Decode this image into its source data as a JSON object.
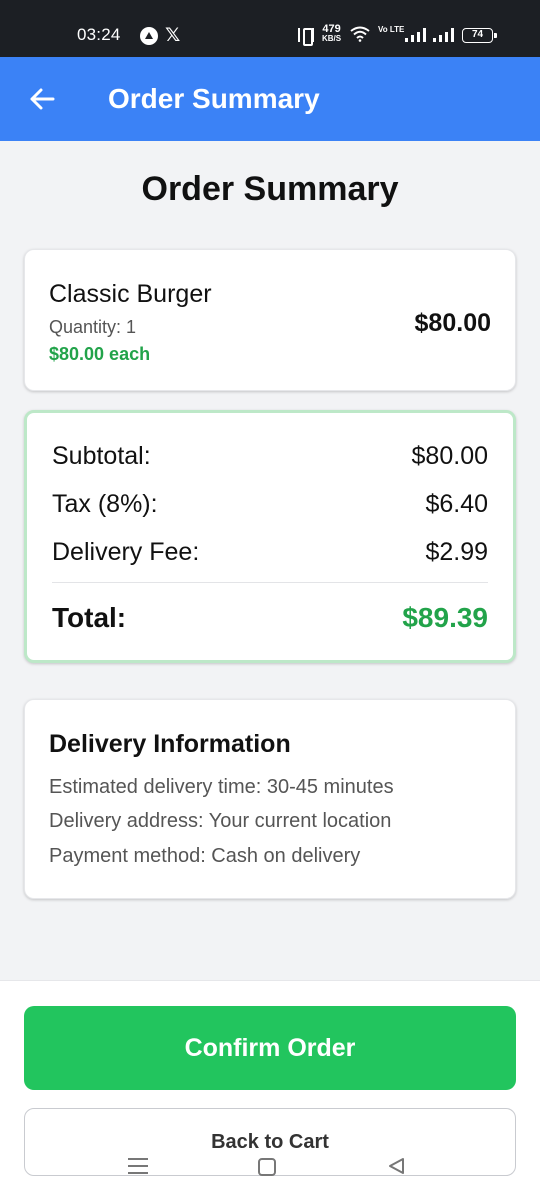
{
  "status_bar": {
    "time": "03:24",
    "speed_value": "479",
    "speed_unit": "KB/S",
    "network": "Vo LTE",
    "battery": "74"
  },
  "app_bar": {
    "title": "Order Summary",
    "back_icon": "arrow-left-icon",
    "color": "#3b82f6"
  },
  "page": {
    "title": "Order Summary"
  },
  "item": {
    "name": "Classic Burger",
    "quantity": "Quantity: 1",
    "unit_price": "$80.00 each",
    "total": "$80.00"
  },
  "totals": {
    "subtotal_label": "Subtotal:",
    "subtotal_value": "$80.00",
    "tax_label": "Tax (8%):",
    "tax_value": "$6.40",
    "delivery_label": "Delivery Fee:",
    "delivery_value": "$2.99",
    "total_label": "Total:",
    "total_value": "$89.39",
    "accent_color": "#22a34a"
  },
  "delivery": {
    "title": "Delivery Information",
    "eta": "Estimated delivery time: 30-45 minutes",
    "address": "Delivery address: Your current location",
    "payment": "Payment method: Cash on delivery"
  },
  "actions": {
    "confirm_label": "Confirm Order",
    "confirm_color": "#22c55e",
    "back_label": "Back to Cart"
  }
}
